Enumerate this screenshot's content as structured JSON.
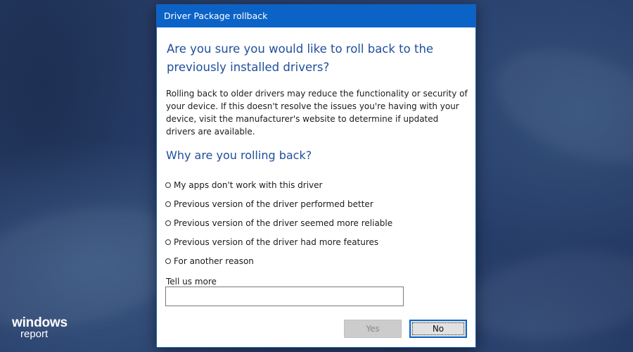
{
  "dialog": {
    "title": "Driver Package rollback",
    "heading": "Are you sure you would like to roll back to the previously installed drivers?",
    "body": "Rolling back to older drivers may reduce the functionality or security of your device.  If this doesn't resolve the issues you're having with your device, visit the manufacturer's website to determine if updated drivers are available.",
    "subheading": "Why are you rolling back?",
    "reasons": [
      "My apps don't work with this driver",
      "Previous version of the driver performed better",
      "Previous version of the driver seemed more reliable",
      "Previous version of the driver had more features",
      "For another reason"
    ],
    "tell_us_label": "Tell us more",
    "tell_us_value": "",
    "yes_label": "Yes",
    "no_label": "No"
  },
  "watermark": {
    "line1": "windows",
    "line2": "report"
  },
  "colors": {
    "titlebar": "#0b63c8",
    "heading": "#1f4e9c",
    "background": "#2a4270"
  }
}
